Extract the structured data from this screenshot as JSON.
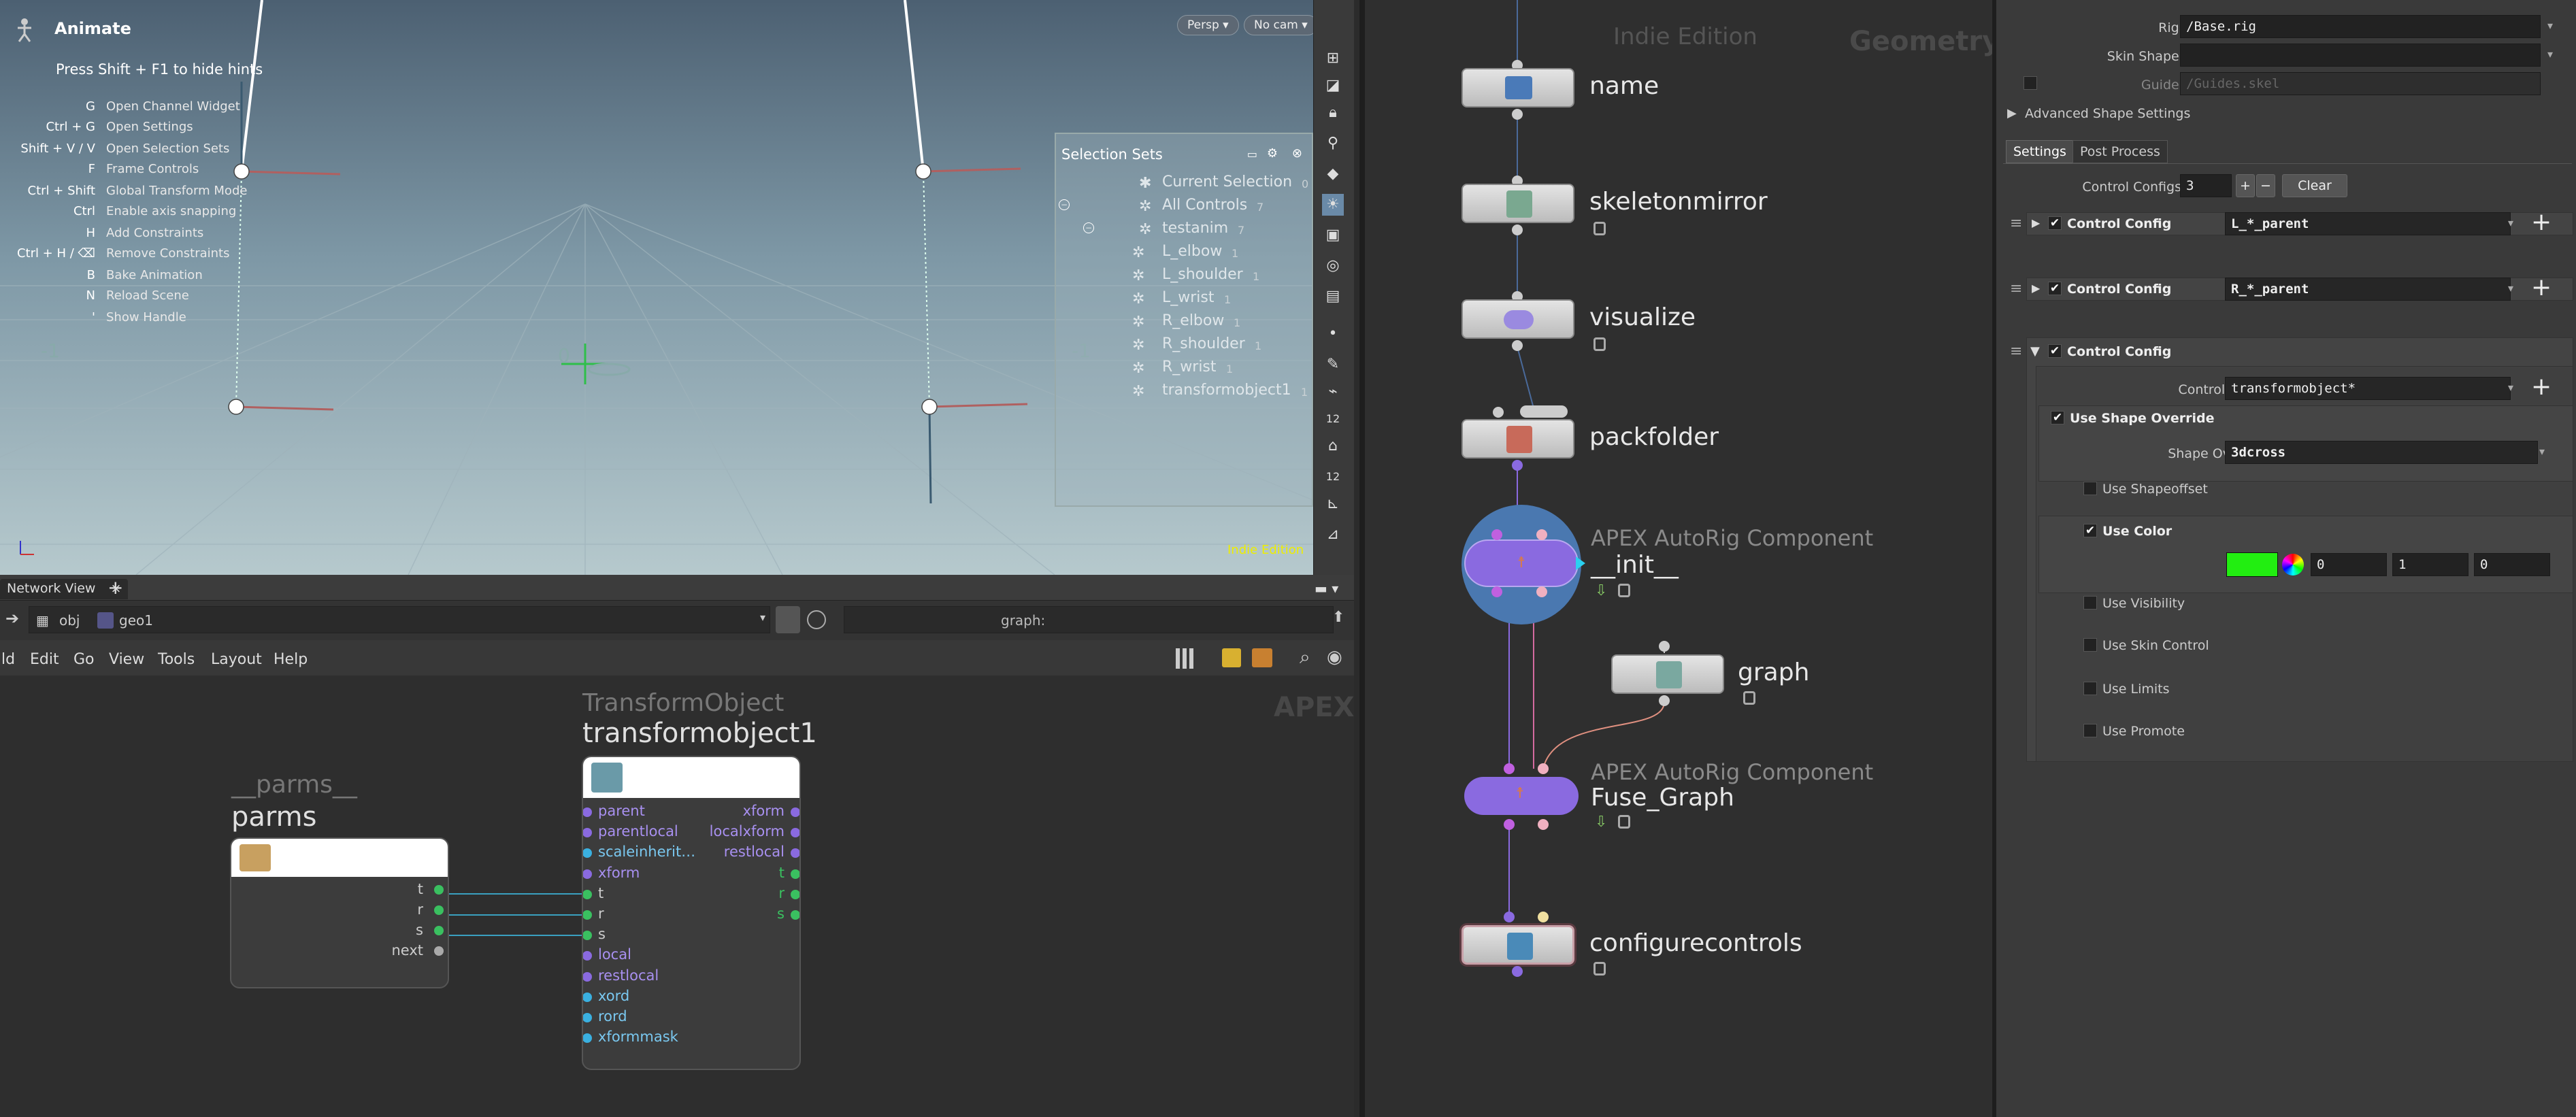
{
  "viewport": {
    "mode_title": "Animate",
    "hide_hint": "Press Shift + F1 to hide hints",
    "hints": [
      {
        "key": "G",
        "desc": "Open Channel Widget"
      },
      {
        "key": "Ctrl + G",
        "desc": "Open Settings"
      },
      {
        "key": "Shift + V / V",
        "desc": "Open Selection Sets"
      },
      {
        "key": "F",
        "desc": "Frame Controls"
      },
      {
        "key": "Ctrl + Shift",
        "desc": "Global Transform Mode"
      },
      {
        "key": "Ctrl",
        "desc": "Enable axis snapping"
      },
      {
        "key": "H",
        "desc": "Add Constraints"
      },
      {
        "key": "Ctrl + H / ⌫",
        "desc": "Remove Constraints"
      },
      {
        "key": "B",
        "desc": "Bake Animation"
      },
      {
        "key": "N",
        "desc": "Reload Scene"
      },
      {
        "key": "'",
        "desc": "Show Handle"
      }
    ],
    "persp_label": "Persp",
    "cam_label": "No cam",
    "watermark": "Indie Edition",
    "selection_sets": {
      "title": "Selection Sets",
      "rows": [
        {
          "label": "Current Selection",
          "count": "0"
        },
        {
          "label": "All Controls",
          "count": "7"
        },
        {
          "label": "testanim",
          "count": "7"
        },
        {
          "label": "L_elbow",
          "count": "1"
        },
        {
          "label": "L_shoulder",
          "count": "1"
        },
        {
          "label": "L_wrist",
          "count": "1"
        },
        {
          "label": "R_elbow",
          "count": "1"
        },
        {
          "label": "R_shoulder",
          "count": "1"
        },
        {
          "label": "R_wrist",
          "count": "1"
        },
        {
          "label": "transformobject1",
          "count": "1"
        }
      ]
    }
  },
  "network": {
    "tab_label": "Network View",
    "path": [
      "obj",
      "geo1"
    ],
    "graph_label": "graph:",
    "menu": [
      "ld",
      "Edit",
      "Go",
      "View",
      "Tools",
      "Layout",
      "Help"
    ],
    "context_label": "APEX",
    "parms_node": {
      "type": "__parms__",
      "name": "parms",
      "outputs": [
        "t",
        "r",
        "s",
        "next"
      ]
    },
    "xform_node": {
      "type": "TransformObject",
      "name": "transformobject1",
      "inputs": [
        "parent",
        "parentlocal",
        "scaleinherit…",
        "xform",
        "t",
        "r",
        "s",
        "local",
        "restlocal",
        "xord",
        "rord",
        "xformmask"
      ],
      "outputs": [
        "xform",
        "localxform",
        "restlocal",
        "t",
        "r",
        "s"
      ]
    }
  },
  "geometry": {
    "watermark": "Indie Edition",
    "context_label": "Geometry",
    "nodes": [
      {
        "name": "name"
      },
      {
        "name": "skeletonmirror"
      },
      {
        "name": "visualize"
      },
      {
        "name": "packfolder"
      },
      {
        "type": "APEX AutoRig Component",
        "name": "__init__"
      },
      {
        "name": "graph"
      },
      {
        "type": "APEX AutoRig Component",
        "name": "Fuse_Graph"
      },
      {
        "name": "configurecontrols"
      }
    ]
  },
  "parms": {
    "rig_source_label": "Rig Source",
    "rig_source_value": "/Base.rig",
    "skin_shape_label": "Skin Shape Source",
    "skin_shape_value": "",
    "guide_source_label": "Guide Source",
    "guide_source_value": "/Guides.skel",
    "advanced_label": "Advanced Shape Settings",
    "tabs": [
      "Settings",
      "Post Process"
    ],
    "control_configs_label": "Control Configs",
    "control_configs_value": "3",
    "clear_label": "Clear",
    "config_label": "Control Config",
    "configs": [
      "L_*_parent",
      "R_*_parent"
    ],
    "control_group_label": "Control Group",
    "control_group_value": "transformobject*",
    "use_shape_override": "Use Shape Override",
    "shape_override_label": "Shape Override",
    "shape_override_value": "3dcross",
    "use_shapeoffset": "Use Shapeoffset",
    "use_color": "Use Color",
    "color_label": "Color",
    "color_hex": "#22ee11",
    "color_values": [
      "0",
      "1",
      "0"
    ],
    "use_visibility": "Use Visibility",
    "use_skin_control": "Use Skin Control",
    "use_limits": "Use Limits",
    "use_promote": "Use Promote"
  }
}
